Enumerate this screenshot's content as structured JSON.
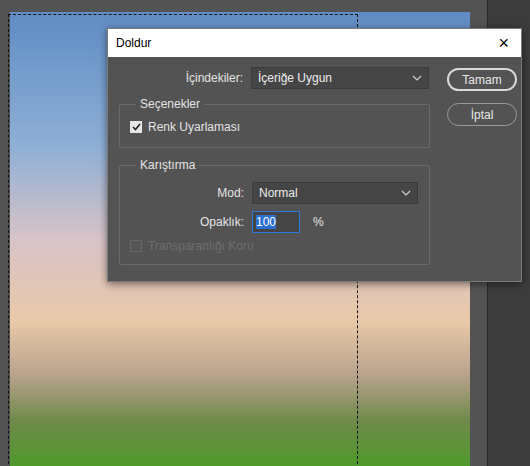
{
  "window": {
    "title": "Doldur",
    "close": "×"
  },
  "contents": {
    "label": "İçindekiler:",
    "value": "İçeriğe Uygun"
  },
  "options": {
    "title": "Seçenekler",
    "checkboxes": [
      {
        "label": "Renk Uyarlaması",
        "checked": true,
        "disabled": false
      }
    ]
  },
  "blending": {
    "title": "Karıştırma",
    "mode": {
      "label": "Mod:",
      "value": "Normal"
    },
    "opacity": {
      "label": "Opaklık:",
      "value": "100",
      "unit": "%",
      "focused": true
    },
    "checkboxes": [
      {
        "label": "Transparanlığı Koru",
        "checked": false,
        "disabled": true
      }
    ]
  },
  "buttons": [
    {
      "label": "Tamam",
      "selected": true
    },
    {
      "label": "İptal",
      "selected": false
    }
  ]
}
